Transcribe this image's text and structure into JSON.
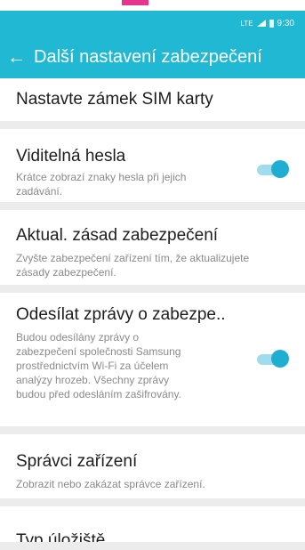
{
  "status_bar": {
    "time": "9:30",
    "network": "LTE"
  },
  "app_bar": {
    "back_icon": "arrow-left-icon",
    "title": "Další nastavení zabezpečení"
  },
  "items": [
    {
      "title": "Nastavte zámek SIM karty"
    },
    {
      "title": "Viditelná hesla",
      "subtitle": "Krátce zobrazí znaky hesla při jejich zadávání.",
      "toggle": "on"
    },
    {
      "title": "Aktual. zásad zabezpečení",
      "subtitle": "Zvyšte zabezpečení zařízení tím, že aktualizujete zásady zabezpečení."
    },
    {
      "title": "Odesílat zprávy o zabezpe..",
      "subtitle": "Budou odesílány zprávy o zabezpečení společnosti Samsung prostřednictvím Wi-Fi za účelem analýzy hrozeb. Všechny zprávy budou před odesláním zašifrovány.",
      "toggle": "on"
    },
    {
      "title": "Správci zařízení",
      "subtitle": "Zobrazit nebo zakázat správce zařízení."
    },
    {
      "title": "Typ úložiště"
    }
  ],
  "colors": {
    "accent": "#21b8d3",
    "toggle_on": "#1faed2"
  }
}
